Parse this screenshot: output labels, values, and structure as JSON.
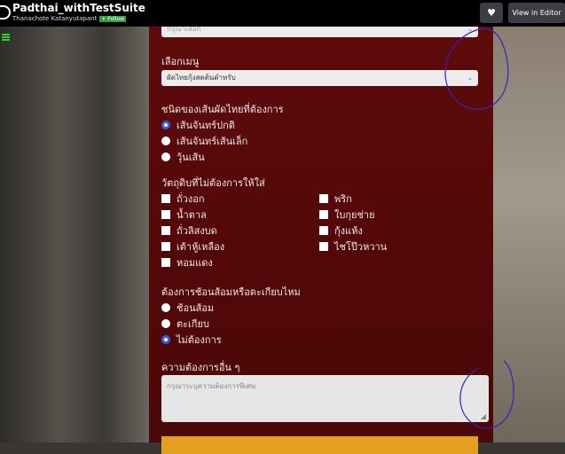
{
  "topbar": {
    "title": "Padthai_withTestSuite",
    "author": "Thanachote Katanyutapant",
    "follow_label": "+ Follow",
    "heart_icon": "heart-icon",
    "view_in_editor": "View in Editor"
  },
  "form": {
    "top_select_placeholder": "กรุณาเลือก",
    "menu_label": "เลือกเมนู",
    "menu_value": "ผัดไทยกุ้งสดต้นตำหรับ",
    "noodle_label": "ชนิดของเส้นผัดไทยที่ต้องการ",
    "noodle_options": [
      {
        "label": "เส้นจันทร์ปกติ",
        "checked": true
      },
      {
        "label": "เส้นจันทร์เส้นเล็ก",
        "checked": false
      },
      {
        "label": "วุ้นเส้น",
        "checked": false
      }
    ],
    "exclude_label": "วัตถุดิบที่ไม่ต้องการให้ใส่",
    "exclude_left": [
      "ถั่วงอก",
      "น้ำตาล",
      "ถั่วลิสงบด",
      "เต้าหู้เหลือง",
      "หอมแดง"
    ],
    "exclude_right": [
      "พริก",
      "ใบกุยช่าย",
      "กุ้งแห้ง",
      "ไชโป๊วหวาน"
    ],
    "utensil_label": "ต้องการช้อนส้อมหรือตะเกียบไหม",
    "utensil_options": [
      {
        "label": "ช้อนส้อม",
        "checked": false
      },
      {
        "label": "ตะเกียบ",
        "checked": false
      },
      {
        "label": "ไม่ต้องการ",
        "checked": true
      }
    ],
    "notes_label": "ความต้องการอื่น ๆ",
    "notes_placeholder": "กรุณาระบุความต้องการพิเศษ"
  },
  "colors": {
    "panel": "#5a0a0a",
    "accent": "#e3a020",
    "radio": "#3d5bd9",
    "annotation": "#3a22b0"
  }
}
